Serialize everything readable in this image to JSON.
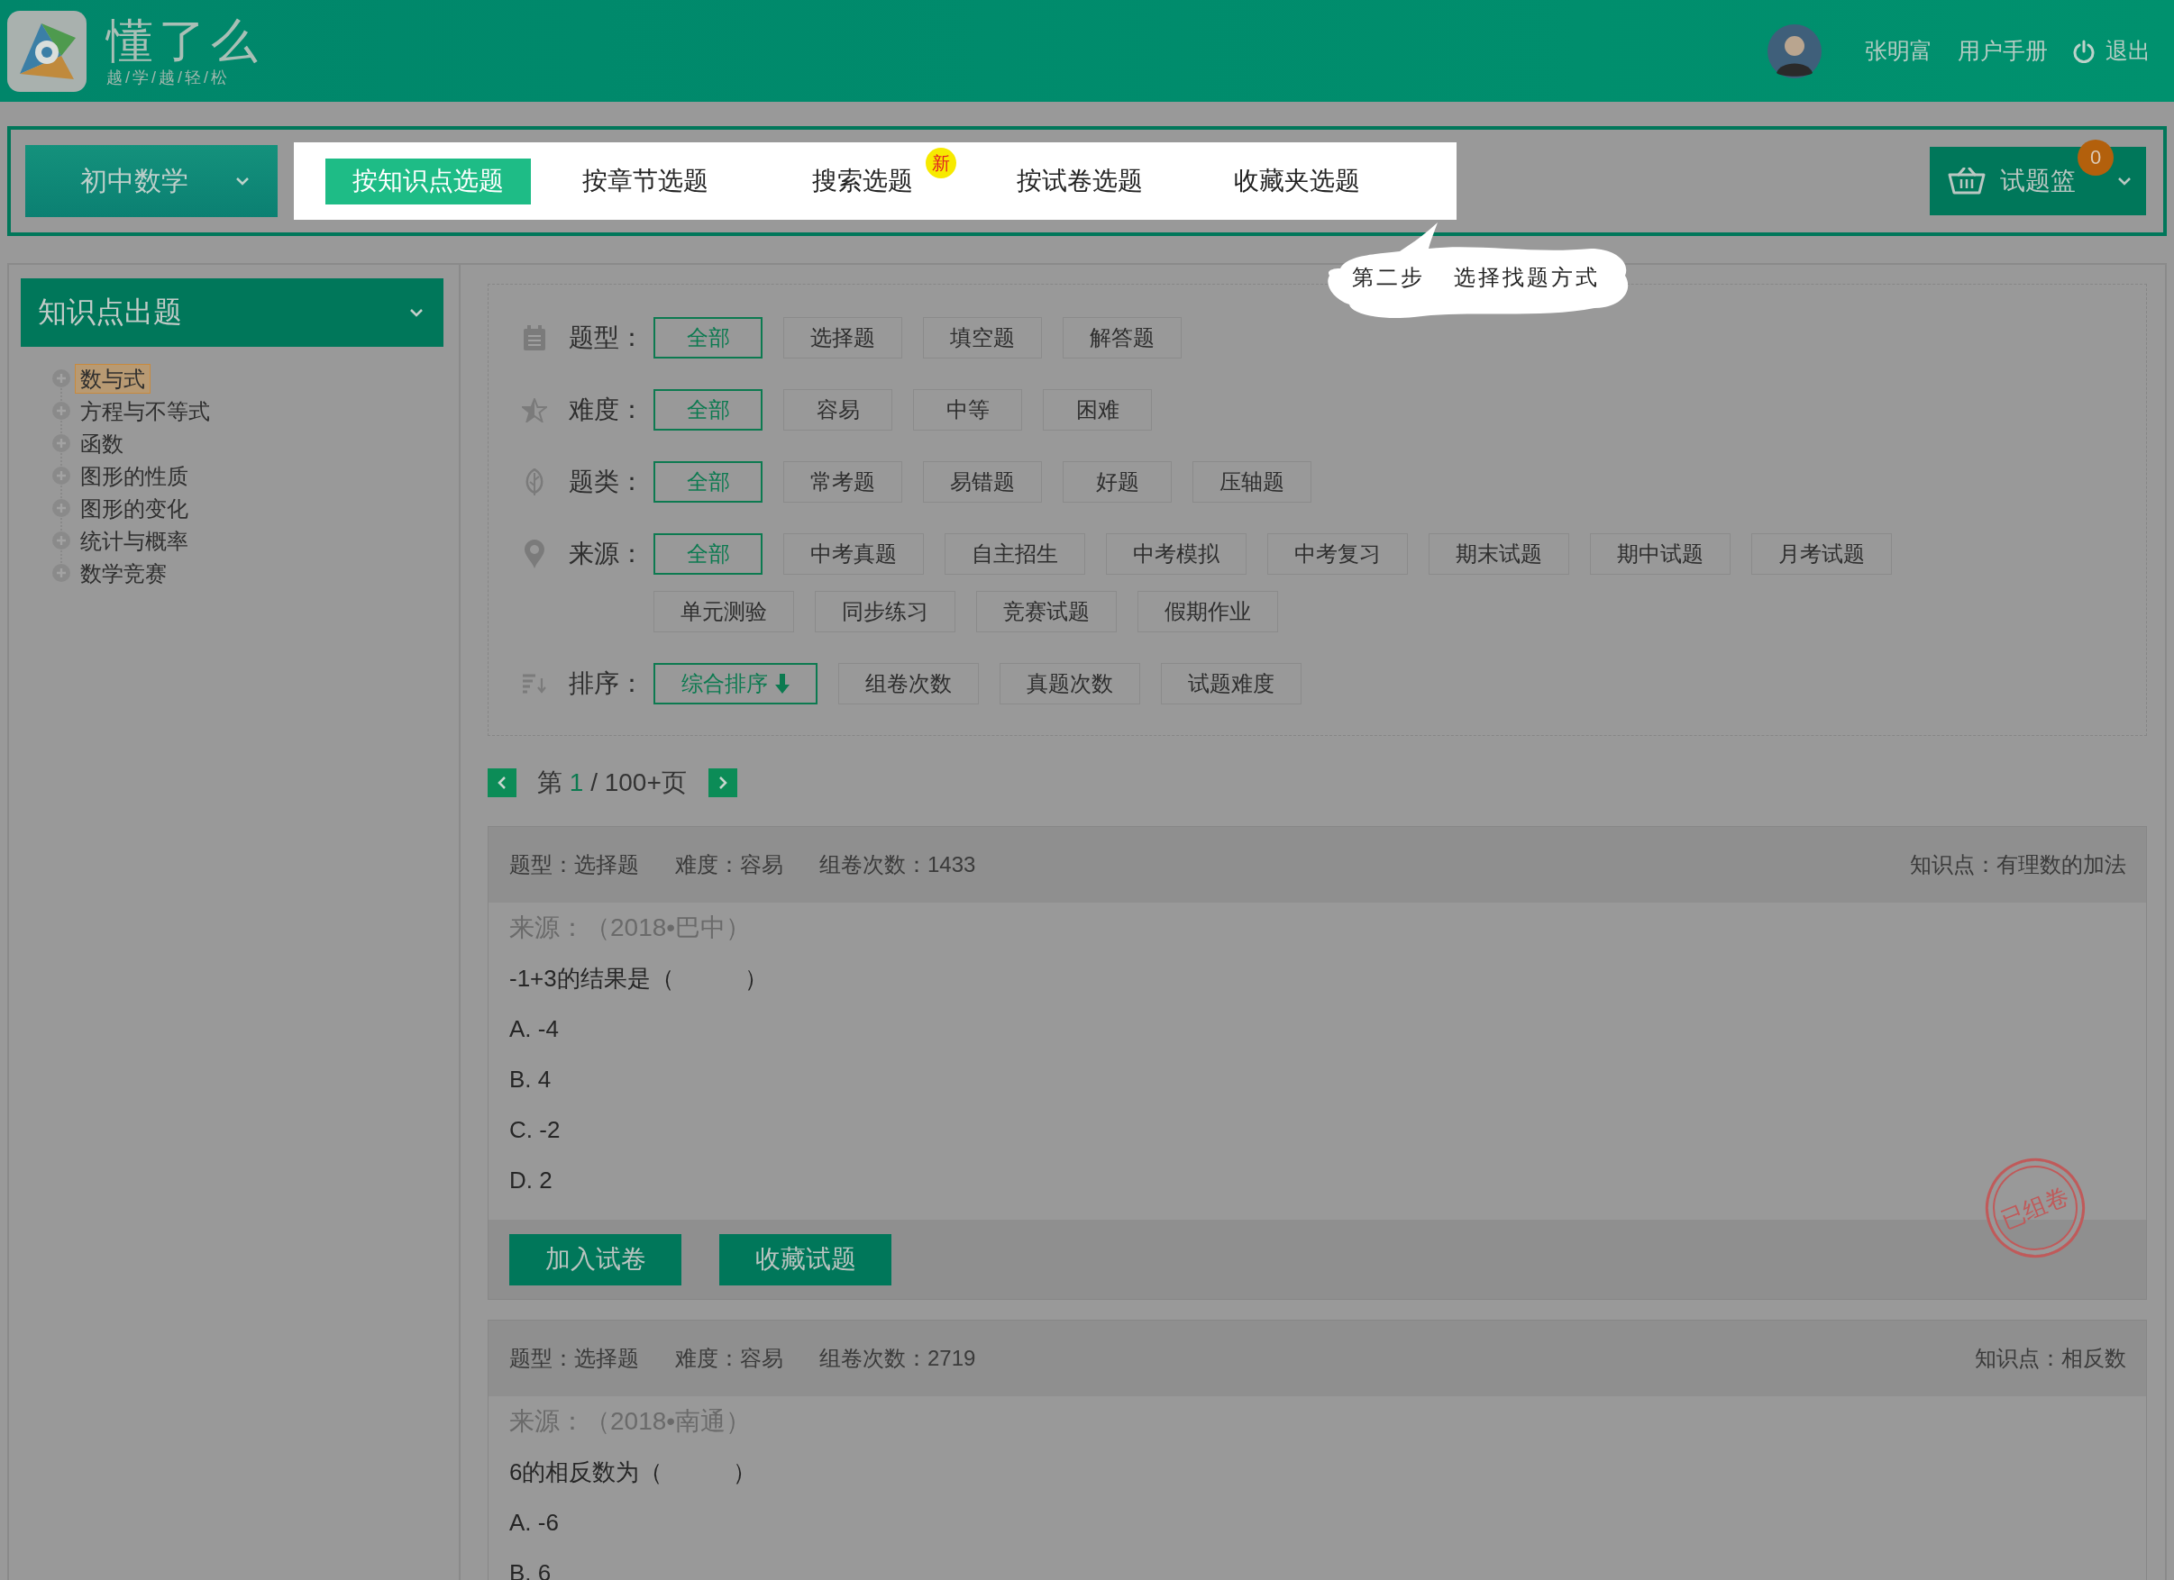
{
  "header": {
    "logo_title": "懂了么",
    "logo_slogan": "越/学/越/轻/松",
    "user_name": "张明富",
    "manual": "用户手册",
    "logout": "退出"
  },
  "nav": {
    "subject": "初中数学",
    "tabs": [
      {
        "label": "按知识点选题",
        "selected": true
      },
      {
        "label": "按章节选题",
        "selected": false
      },
      {
        "label": "搜索选题",
        "selected": false,
        "badge": "新"
      },
      {
        "label": "按试卷选题",
        "selected": false
      },
      {
        "label": "收藏夹选题",
        "selected": false
      }
    ],
    "basket": {
      "label": "试题篮",
      "count": "0"
    }
  },
  "guide_tip": {
    "step": "第二步",
    "text": "选择找题方式"
  },
  "sidebar": {
    "title": "知识点出题",
    "items": [
      {
        "label": "数与式",
        "selected": true
      },
      {
        "label": "方程与不等式",
        "selected": false
      },
      {
        "label": "函数",
        "selected": false
      },
      {
        "label": "图形的性质",
        "selected": false
      },
      {
        "label": "图形的变化",
        "selected": false
      },
      {
        "label": "统计与概率",
        "selected": false
      },
      {
        "label": "数学竞赛",
        "selected": false
      }
    ]
  },
  "filters": [
    {
      "kind": "type",
      "label": "题型：",
      "options": [
        {
          "label": "全部",
          "selected": true
        },
        {
          "label": "选择题",
          "selected": false
        },
        {
          "label": "填空题",
          "selected": false
        },
        {
          "label": "解答题",
          "selected": false
        }
      ]
    },
    {
      "kind": "difficulty",
      "label": "难度：",
      "options": [
        {
          "label": "全部",
          "selected": true
        },
        {
          "label": "容易",
          "selected": false
        },
        {
          "label": "中等",
          "selected": false
        },
        {
          "label": "困难",
          "selected": false
        }
      ]
    },
    {
      "kind": "category",
      "label": "题类：",
      "options": [
        {
          "label": "全部",
          "selected": true
        },
        {
          "label": "常考题",
          "selected": false
        },
        {
          "label": "易错题",
          "selected": false
        },
        {
          "label": "好题",
          "selected": false
        },
        {
          "label": "压轴题",
          "selected": false
        }
      ]
    },
    {
      "kind": "source",
      "label": "来源：",
      "options": [
        {
          "label": "全部",
          "selected": true
        },
        {
          "label": "中考真题",
          "selected": false
        },
        {
          "label": "自主招生",
          "selected": false
        },
        {
          "label": "中考模拟",
          "selected": false
        },
        {
          "label": "中考复习",
          "selected": false
        },
        {
          "label": "期末试题",
          "selected": false
        },
        {
          "label": "期中试题",
          "selected": false
        },
        {
          "label": "月考试题",
          "selected": false
        },
        {
          "label": "单元测验",
          "selected": false
        },
        {
          "label": "同步练习",
          "selected": false
        },
        {
          "label": "竞赛试题",
          "selected": false
        },
        {
          "label": "假期作业",
          "selected": false
        }
      ]
    },
    {
      "kind": "sort",
      "label": "排序：",
      "options": [
        {
          "label": "综合排序",
          "selected": true
        },
        {
          "label": "组卷次数",
          "selected": false
        },
        {
          "label": "真题次数",
          "selected": false
        },
        {
          "label": "试题难度",
          "selected": false
        }
      ]
    }
  ],
  "pagination": {
    "prefix": "第",
    "current": "1",
    "suffix": "/ 100+页"
  },
  "questions": [
    {
      "meta": [
        "题型：选择题",
        "难度：容易",
        "组卷次数：1433"
      ],
      "knowledge": "知识点：有理数的加法",
      "source": "来源：（2018•巴中）",
      "stem": "-1+3的结果是（　　　）",
      "options": [
        "A. -4",
        "B. 4",
        "C. -2",
        "D. 2"
      ],
      "buttons": [
        "加入试卷",
        "收藏试题"
      ],
      "stamp": "已组卷"
    },
    {
      "meta": [
        "题型：选择题",
        "难度：容易",
        "组卷次数：2719"
      ],
      "knowledge": "知识点：相反数",
      "source": "来源：（2018•南通）",
      "stem": "6的相反数为（　　　）",
      "options": [
        "A. -6",
        "B. 6"
      ]
    }
  ]
}
